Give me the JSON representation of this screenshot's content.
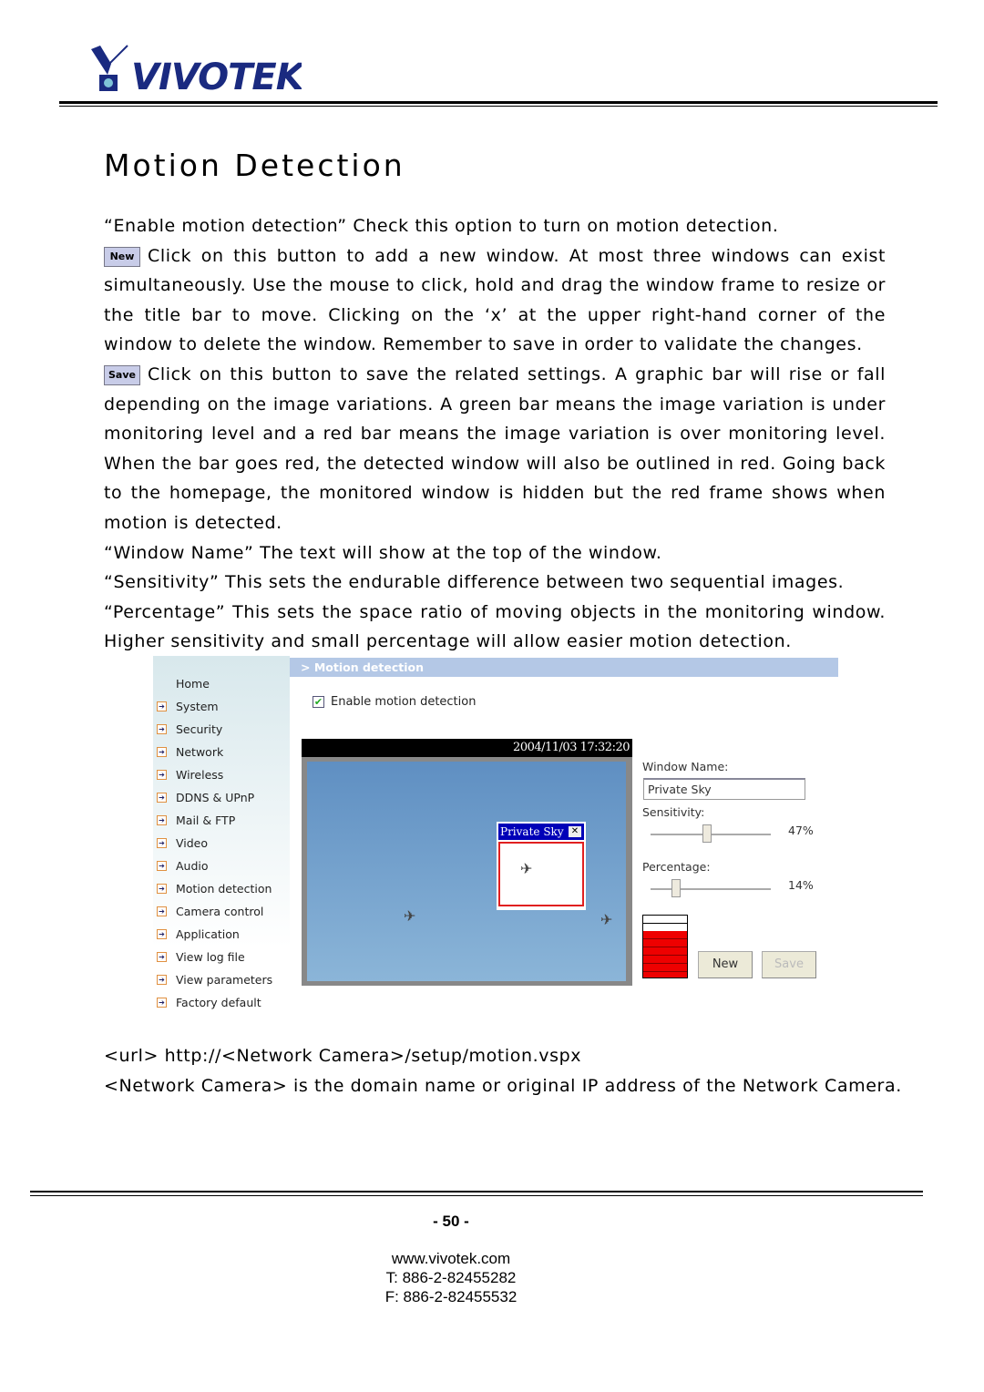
{
  "logo": {
    "text": "VIVOTEK",
    "brand_color": "#1a2a80"
  },
  "title": "Motion Detection",
  "paragraphs": {
    "p1": "“Enable motion detection” Check this option to turn on motion detection.",
    "new_icon_label": "New",
    "p2": "Click on this button to add a new window. At most three windows can exist simultaneously. Use the mouse to click, hold and drag the window frame to resize or the title bar to move. Clicking on the ‘x’ at the upper right-hand corner of the window to delete the window. Remember to save in order to validate the changes.",
    "save_icon_label": "Save",
    "p3": "Click on this button to save the related settings. A graphic bar will rise or fall depending on the image variations. A green bar means the image variation is under monitoring level and a red bar means the image variation is over monitoring level. When the bar goes red, the detected window will also be outlined in red. Going back to the homepage, the monitored window is hidden but the red frame shows when motion is detected.",
    "p4": "“Window Name” The text will show at the top of the window.",
    "p5": "“Sensitivity” This sets the endurable difference between two sequential images.",
    "p6": "“Percentage” This sets the space ratio of moving objects in the monitoring window. Higher sensitivity and small percentage will allow easier motion detection."
  },
  "screenshot": {
    "header": "> Motion detection",
    "nav": [
      "Home",
      "System",
      "Security",
      "Network",
      "Wireless",
      "DDNS & UPnP",
      "Mail & FTP",
      "Video",
      "Audio",
      "Motion detection",
      "Camera control",
      "Application",
      "View log file",
      "View parameters",
      "Factory default"
    ],
    "enable_label": "Enable motion detection",
    "enable_checked": true,
    "timestamp": "2004/11/03 17:32:20",
    "window_title": "Private Sky",
    "window_name_label": "Window Name:",
    "window_name_value": "Private Sky",
    "sensitivity_label": "Sensitivity:",
    "sensitivity_value": "47%",
    "sensitivity": 47,
    "percentage_label": "Percentage:",
    "percentage_value": "14%",
    "percentage": 14,
    "level_fill_percent": 75,
    "level_color": "#ee0000",
    "new_button": "New",
    "save_button": "Save"
  },
  "url_line": "<url> http://<Network Camera>/setup/motion.vspx",
  "url_note": "<Network Camera> is the domain name or original IP address of the Network Camera.",
  "footer": {
    "page": "- 50 -",
    "website": "www.vivotek.com",
    "tel": "T: 886-2-82455282",
    "fax": "F: 886-2-82455532"
  }
}
